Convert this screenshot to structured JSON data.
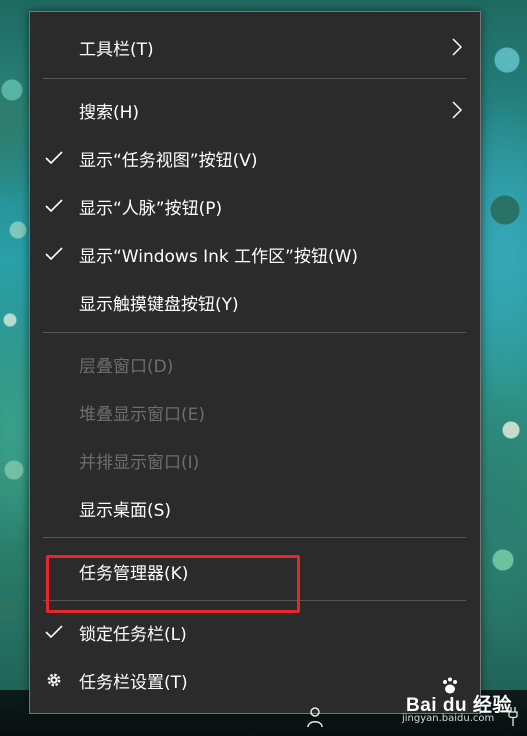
{
  "menu": {
    "items": [
      {
        "label": "工具栏(T)",
        "submenu": true,
        "checked": false,
        "disabled": false
      },
      {
        "label": "搜索(H)",
        "submenu": true,
        "checked": false,
        "disabled": false
      },
      {
        "label": "显示“任务视图”按钮(V)",
        "checked": true,
        "disabled": false
      },
      {
        "label": "显示“人脉”按钮(P)",
        "checked": true,
        "disabled": false
      },
      {
        "label": "显示“Windows Ink 工作区”按钮(W)",
        "checked": true,
        "disabled": false
      },
      {
        "label": "显示触摸键盘按钮(Y)",
        "checked": false,
        "disabled": false
      },
      {
        "label": "层叠窗口(D)",
        "checked": false,
        "disabled": true
      },
      {
        "label": "堆叠显示窗口(E)",
        "checked": false,
        "disabled": true
      },
      {
        "label": "并排显示窗口(I)",
        "checked": false,
        "disabled": true
      },
      {
        "label": "显示桌面(S)",
        "checked": false,
        "disabled": false
      },
      {
        "label": "任务管理器(K)",
        "checked": false,
        "disabled": false,
        "highlighted": true
      },
      {
        "label": "锁定任务栏(L)",
        "checked": true,
        "disabled": false
      },
      {
        "label": "任务栏设置(T)",
        "icon": "gear-icon",
        "disabled": false
      }
    ]
  },
  "highlight_color": "#e8262b",
  "watermark": {
    "brand": "Bai du 经验",
    "url": "jingyan.baidu.com"
  }
}
